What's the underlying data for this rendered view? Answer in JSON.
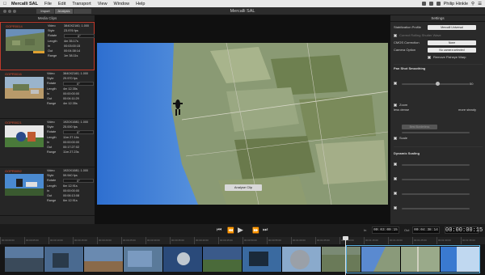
{
  "menubar": {
    "app": "Mercalli SAL",
    "items": [
      "File",
      "Edit",
      "Transport",
      "View",
      "Window",
      "Help"
    ],
    "user": "Philip Hinkle"
  },
  "window": {
    "title": "Mercalli SAL",
    "view_buttons": [
      "Import",
      "Analysis",
      ""
    ]
  },
  "left_panel": {
    "title": "Media Clips",
    "clips": [
      {
        "name": "GOPR0014",
        "video": "3840X2160, 1.000",
        "video_sub": "23.976 fps",
        "rotate": "0°",
        "length": "4m 35.17s",
        "in": "00:03:00:15",
        "out": "00:04:38:14",
        "range": "1m 38.11s"
      },
      {
        "name": "GOPR0016",
        "video": "3840X2160, 1.000",
        "video_sub": "29.970 fps",
        "rotate": "0°",
        "length": "4m 12.35s",
        "in": "00:00:00:00",
        "out": "00:04:11:29",
        "range": "4m 12.35s"
      },
      {
        "name": "GOPR0021",
        "video": "1920X1080, 1.000",
        "video_sub": "25.000 fps",
        "rotate": "0°",
        "length": "11m 27.14s",
        "in": "00:00:00:00",
        "out": "00:17:27:02",
        "range": "11m 27.23s"
      },
      {
        "name": "GOPR0052",
        "video": "1920X1080, 1.000",
        "video_sub": "59.940 fps",
        "rotate": "0°",
        "length": "6m 12.91s",
        "in": "00:00:00:00",
        "out": "00:06:13:08",
        "range": "6m 12.91s"
      }
    ],
    "labels": {
      "video": "Video",
      "style": "Style",
      "rotate": "Rotate",
      "length": "Length",
      "in": "In",
      "out": "Out",
      "range": "Range"
    }
  },
  "viewer": {
    "analyse_button": "Analyse Clip"
  },
  "settings": {
    "title": "Settings",
    "profile_label": "Stabilization Profile",
    "profile_value": "Mercalli Universal",
    "correct_rolling_label": "Correct Rolling Shutter Wave",
    "cmos_label": "CMOS Correction",
    "cmos_value": "None",
    "camera_label": "Camera Option",
    "camera_value": "No camera selected",
    "fisheye_label": "Remove Fisheye Warp",
    "pan_section": "Pan Shot Smoothing",
    "pan_value": "50",
    "pan_left": "less dense",
    "pan_right": "more steady",
    "zoom_label": "Zoom",
    "scale_button": "Best Borderless",
    "scale_label": "Scale",
    "dynamic_section": "Dynamic Scaling"
  },
  "transport": {
    "in_label": "In",
    "in_tc": "00:03:00:15",
    "out_label": "Out",
    "out_tc": "00:04:38:14",
    "current_tc": "00:00:00:15"
  },
  "timeline": {
    "ticks": [
      "00:00:00:00",
      "00:00:05:00",
      "00:00:10:00",
      "00:00:15:00",
      "00:00:20:00",
      "00:00:25:00",
      "00:00:30:00",
      "00:00:35:00",
      "00:00:40:00",
      "00:00:45:00",
      "00:00:50:00",
      "00:00:55:00",
      "00:01:00:00",
      "00:01:05:00",
      "00:01:10:00",
      "00:01:15:00",
      "00:01:20:00",
      "00:01:25:00",
      "00:01:30:00",
      "00:01:35:00"
    ]
  }
}
